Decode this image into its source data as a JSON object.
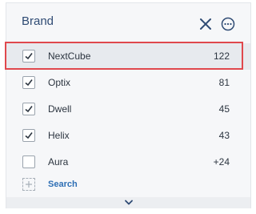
{
  "header": {
    "title": "Brand",
    "close_icon": "close-icon",
    "more_icon": "more-options-icon"
  },
  "items": [
    {
      "label": "NextCube",
      "count": "122",
      "checked": true,
      "highlighted": true
    },
    {
      "label": "Optix",
      "count": "81",
      "checked": true,
      "highlighted": false
    },
    {
      "label": "Dwell",
      "count": "45",
      "checked": true,
      "highlighted": false
    },
    {
      "label": "Helix",
      "count": "43",
      "checked": true,
      "highlighted": false
    },
    {
      "label": "Aura",
      "count": "+24",
      "checked": false,
      "highlighted": false
    }
  ],
  "search": {
    "label": "Search",
    "icon": "dashed-plus-icon"
  },
  "footer": {
    "icon": "chevron-down-icon"
  },
  "colors": {
    "title": "#2f4b74",
    "accent": "#2e6fb5",
    "highlight_border": "#e0484d"
  }
}
